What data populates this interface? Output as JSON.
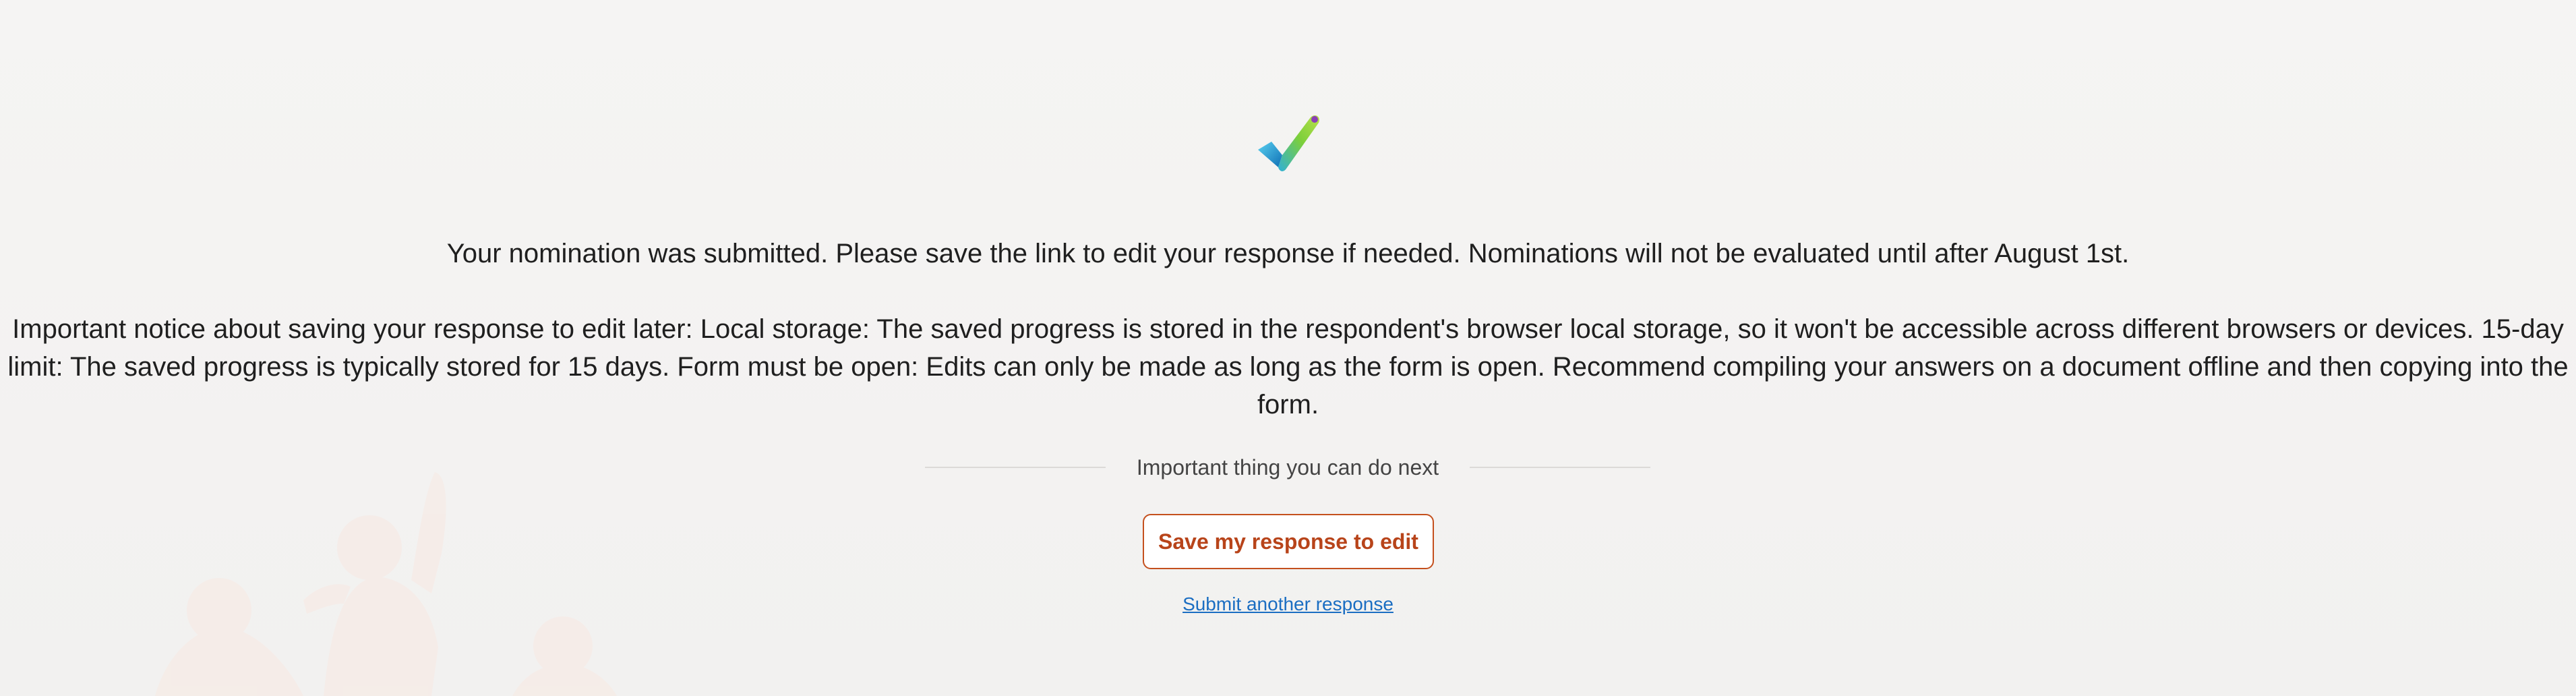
{
  "confirmation": {
    "icon": "checkmark-icon",
    "headline": "Your nomination was submitted. Please save the link to edit your response if needed. Nominations will not be evaluated until after August 1st.",
    "notice": "Important notice about saving your response to edit later: Local storage: The saved progress is stored in the respondent's browser local storage, so it won't be accessible across different browsers or devices. 15-day limit: The saved progress is typically stored for 15 days. Form must be open: Edits can only be made as long as the form is open. Recommend compiling your answers on a document offline and then copying into the form."
  },
  "next_steps": {
    "divider_label": "Important thing you can do next",
    "save_button_label": "Save my response to edit",
    "submit_another_label": "Submit another response"
  },
  "colors": {
    "background": "#f3f2f1",
    "accent": "#c4501d",
    "link": "#1b6ec2"
  }
}
